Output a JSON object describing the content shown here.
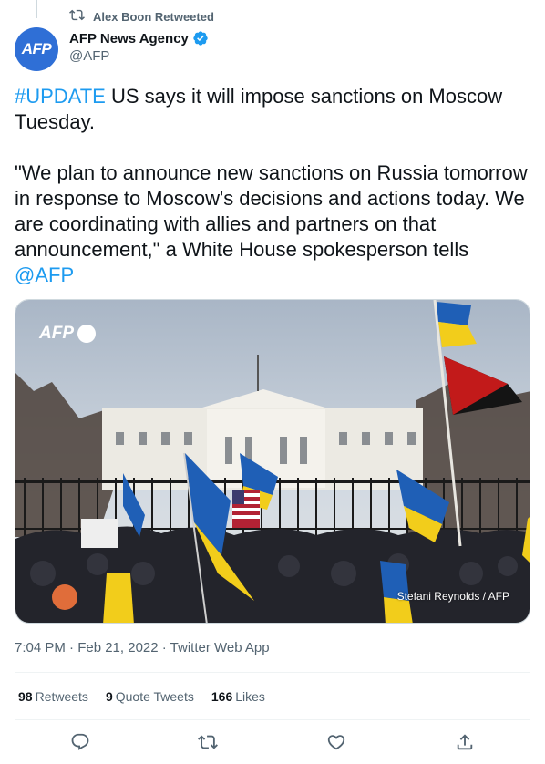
{
  "retweet": {
    "label": "Alex Boon Retweeted"
  },
  "author": {
    "avatar_text": "AFP",
    "name": "AFP News Agency",
    "handle": "@AFP"
  },
  "tweet": {
    "hashtag": "#UPDATE",
    "text_part1": " US says it will impose sanctions on Moscow Tuesday.\n\n\"We plan to announce new sanctions on Russia tomorrow in response to Moscow's decisions and actions today. We are coordinating with allies and partners on that announcement,\" a White House spokesperson tells ",
    "mention": "@AFP"
  },
  "media": {
    "logo": "AFP",
    "credit": "Stefani Reynolds / AFP"
  },
  "meta": {
    "timestamp": "7:04 PM · Feb 21, 2022 · Twitter Web App"
  },
  "stats": {
    "retweets_count": "98",
    "retweets_label": "Retweets",
    "quotes_count": "9",
    "quotes_label": "Quote Tweets",
    "likes_count": "166",
    "likes_label": "Likes"
  },
  "actions": [
    "reply-icon",
    "retweet-icon",
    "like-icon",
    "share-icon"
  ],
  "colors": {
    "link": "#1d9bf0",
    "secondary_text": "#536471",
    "ukraine_blue": "#1f5fb6",
    "ukraine_yellow": "#f2cd1b"
  }
}
